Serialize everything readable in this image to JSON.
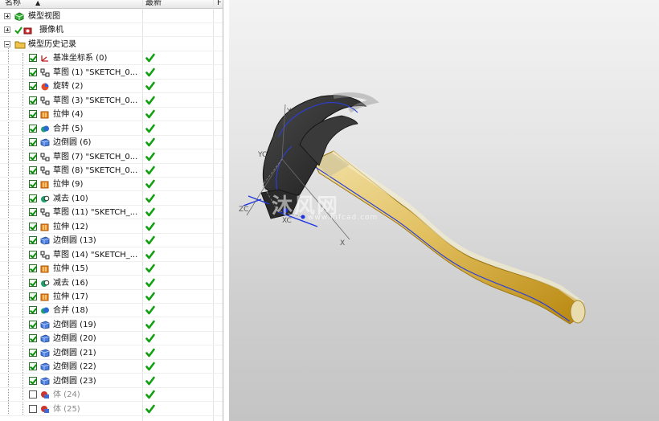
{
  "navigator": {
    "header": {
      "name_col": "名称",
      "name_sort": "▲",
      "latest_col": "最新",
      "extra_col": "F"
    },
    "top_nodes": [
      {
        "label": "模型视图",
        "expander": "+",
        "icon": "model-views-icon"
      },
      {
        "label": "摄像机",
        "expander": "+",
        "icon": "camera-icon"
      },
      {
        "label": "模型历史记录",
        "expander": "-",
        "icon": "folder-icon"
      }
    ],
    "features": [
      {
        "label": "基准坐标系 (0)",
        "icon": "datum-csys-icon",
        "checked": true,
        "latest": true
      },
      {
        "label": "草图 (1) \"SKETCH_0...",
        "icon": "sketch-icon",
        "checked": true,
        "latest": true
      },
      {
        "label": "旋转 (2)",
        "icon": "revolve-icon",
        "checked": true,
        "latest": true
      },
      {
        "label": "草图 (3) \"SKETCH_0...",
        "icon": "sketch-icon",
        "checked": true,
        "latest": true
      },
      {
        "label": "拉伸 (4)",
        "icon": "extrude-icon",
        "checked": true,
        "latest": true
      },
      {
        "label": "合并 (5)",
        "icon": "unite-icon",
        "checked": true,
        "latest": true
      },
      {
        "label": "边倒圆 (6)",
        "icon": "edge-blend-icon",
        "checked": true,
        "latest": true
      },
      {
        "label": "草图 (7) \"SKETCH_0...",
        "icon": "sketch-icon",
        "checked": true,
        "latest": true
      },
      {
        "label": "草图 (8) \"SKETCH_0...",
        "icon": "sketch-icon",
        "checked": true,
        "latest": true
      },
      {
        "label": "拉伸 (9)",
        "icon": "extrude-icon",
        "checked": true,
        "latest": true
      },
      {
        "label": "减去 (10)",
        "icon": "subtract-icon",
        "checked": true,
        "latest": true
      },
      {
        "label": "草图 (11) \"SKETCH_...",
        "icon": "sketch-icon",
        "checked": true,
        "latest": true
      },
      {
        "label": "拉伸 (12)",
        "icon": "extrude-icon",
        "checked": true,
        "latest": true
      },
      {
        "label": "边倒圆 (13)",
        "icon": "edge-blend-icon",
        "checked": true,
        "latest": true
      },
      {
        "label": "草图 (14) \"SKETCH_...",
        "icon": "sketch-icon",
        "checked": true,
        "latest": true
      },
      {
        "label": "拉伸 (15)",
        "icon": "extrude-icon",
        "checked": true,
        "latest": true
      },
      {
        "label": "减去 (16)",
        "icon": "subtract-icon",
        "checked": true,
        "latest": true
      },
      {
        "label": "拉伸 (17)",
        "icon": "extrude-icon",
        "checked": true,
        "latest": true
      },
      {
        "label": "合并 (18)",
        "icon": "unite-icon",
        "checked": true,
        "latest": true
      },
      {
        "label": "边倒圆 (19)",
        "icon": "edge-blend-icon",
        "checked": true,
        "latest": true
      },
      {
        "label": "边倒圆 (20)",
        "icon": "edge-blend-icon",
        "checked": true,
        "latest": true
      },
      {
        "label": "边倒圆 (21)",
        "icon": "edge-blend-icon",
        "checked": true,
        "latest": true
      },
      {
        "label": "边倒圆 (22)",
        "icon": "edge-blend-icon",
        "checked": true,
        "latest": true
      },
      {
        "label": "边倒圆 (23)",
        "icon": "edge-blend-icon",
        "checked": true,
        "latest": true
      },
      {
        "label": "体 (24)",
        "icon": "body-icon",
        "checked": false,
        "latest": true,
        "dim": true
      },
      {
        "label": "体 (25)",
        "icon": "body-icon",
        "checked": false,
        "latest": true,
        "dim": true
      }
    ]
  },
  "viewport": {
    "watermark": "沐风网",
    "watermark_url": "www.mfcad.com",
    "axes": {
      "y": "Y",
      "yc": "YC",
      "zc": "ZC",
      "xc": "XC",
      "x": "X"
    },
    "colors": {
      "handle": "#d9a21c",
      "handle_light": "#f1e1a8",
      "head": "#2f2f2f",
      "edge": "#2a3fd9"
    }
  }
}
